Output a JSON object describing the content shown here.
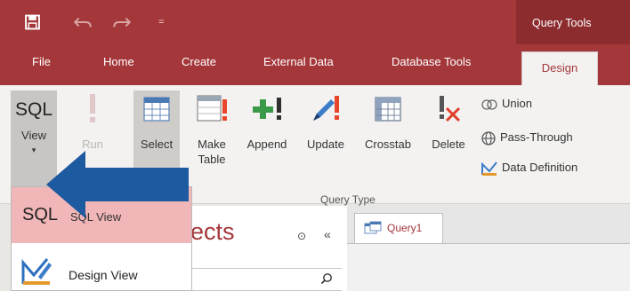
{
  "qat": {
    "more": "="
  },
  "title": {
    "context_tools": "Query Tools"
  },
  "tabs": [
    {
      "label": "File"
    },
    {
      "label": "Home"
    },
    {
      "label": "Create"
    },
    {
      "label": "External Data"
    },
    {
      "label": "Database Tools"
    },
    {
      "label": "Design"
    }
  ],
  "ribbon": {
    "view": {
      "top": "SQL",
      "label": "View",
      "caret": "▾"
    },
    "run": {
      "label": "Run"
    },
    "select": {
      "label": "Select"
    },
    "make_table": {
      "label1": "Make",
      "label2": "Table"
    },
    "append": {
      "label": "Append"
    },
    "update": {
      "label": "Update"
    },
    "crosstab": {
      "label": "Crosstab"
    },
    "delete": {
      "label": "Delete"
    },
    "union": {
      "label": "Union"
    },
    "pass_through": {
      "label": "Pass-Through"
    },
    "data_definition": {
      "label": "Data Definition"
    },
    "group_label": "Query Type"
  },
  "view_menu": {
    "sql_view": {
      "big": "SQL",
      "label": "SQL View"
    },
    "design_view": {
      "label": "Design View"
    }
  },
  "nav_pane": {
    "title": "ects",
    "btn_circle": "⊙",
    "btn_collapse": "«"
  },
  "document_tabs": [
    {
      "label": "Query1"
    }
  ],
  "colors": {
    "accent": "#a4373a",
    "arrow": "#1e5aa0",
    "highlight": "#f0b6b8"
  }
}
